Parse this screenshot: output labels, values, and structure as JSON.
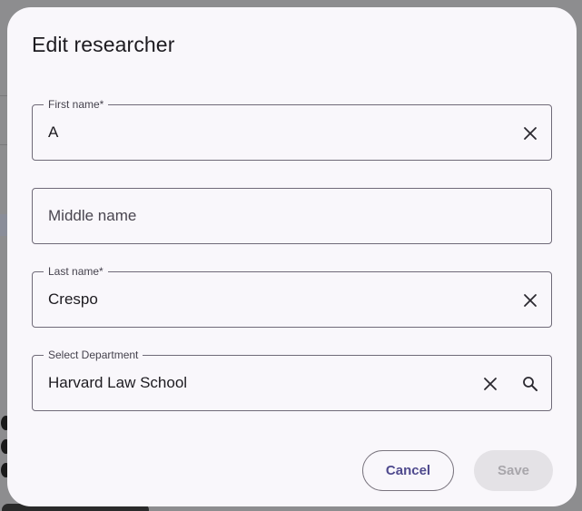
{
  "dialog": {
    "title": "Edit researcher",
    "fields": {
      "first_name": {
        "label": "First name*",
        "value": "A"
      },
      "middle_name": {
        "placeholder": "Middle name"
      },
      "last_name": {
        "label": "Last name*",
        "value": "Crespo"
      },
      "department": {
        "label": "Select Department",
        "value": "Harvard Law School"
      }
    },
    "actions": {
      "cancel_label": "Cancel",
      "save_label": "Save"
    }
  },
  "icons": [
    "close-icon",
    "search-icon"
  ],
  "colors": {
    "dialog_bg": "#f9f7fb",
    "border": "#6f6a78",
    "cancel_text": "#4f4a8e",
    "save_disabled_bg": "#e4e2e6",
    "save_disabled_text": "#a8a6ab",
    "scrim": "#8f8f8f"
  }
}
